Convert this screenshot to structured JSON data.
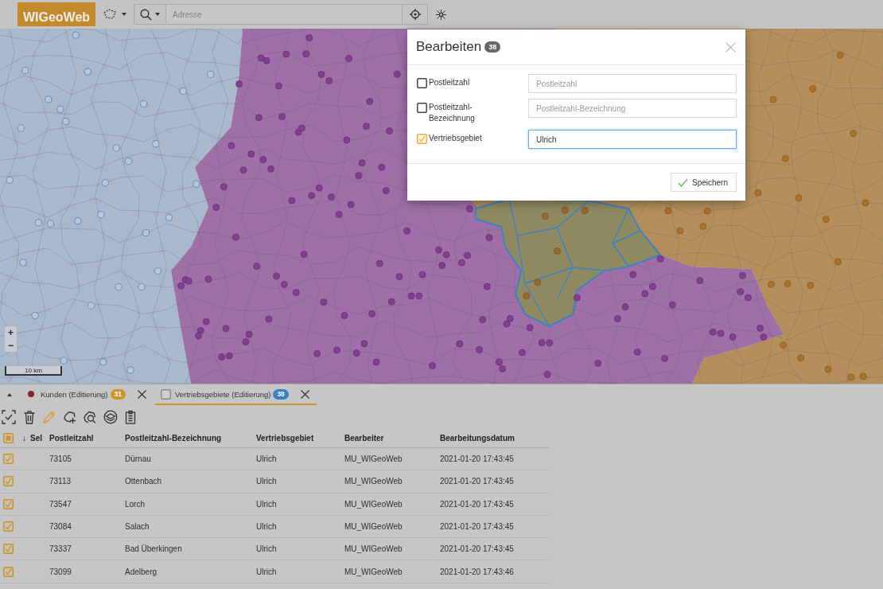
{
  "toolbar": {
    "logo": "WIGeoWeb",
    "address_field": {
      "placeholder": "Adresse"
    }
  },
  "map": {
    "zoom_in": "+",
    "zoom_out": "−",
    "scale_label": "10 km"
  },
  "dialog": {
    "title": "Bearbeiten",
    "count": "38",
    "fields": [
      {
        "label": "Postleitzahl",
        "checked": false,
        "placeholder": "Postleitzahl",
        "focused": false
      },
      {
        "label": "Postleitzahl-Bezeichnung",
        "checked": false,
        "placeholder": "Postleitzahl-Bezeichnung",
        "focused": false
      },
      {
        "label": "Vertriebsgebiet",
        "checked": true,
        "value": "Ulrich",
        "focused": true
      }
    ],
    "save_button": "Speichern"
  },
  "panel": {
    "tabs": [
      {
        "kind": "dot",
        "label": "Kunden (Editierung)",
        "count": "31",
        "color": "#c8962a",
        "marker": {
          "color": "#8b2232"
        },
        "selected": false
      },
      {
        "kind": "checkbox",
        "label": "Vertriebsgebiete (Editierung)",
        "count": "38",
        "color": "#3b7fc4",
        "checked": false,
        "selected": true
      }
    ],
    "tools": [
      {
        "kind": "select",
        "active": false
      },
      {
        "kind": "delete",
        "active": false
      },
      {
        "kind": "edit",
        "active": true
      },
      {
        "kind": "add-area",
        "active": false
      },
      {
        "kind": "search-area",
        "active": false
      },
      {
        "kind": "layers",
        "active": false
      },
      {
        "kind": "report",
        "active": false
      }
    ],
    "table": {
      "select_all": {
        "checked": true
      },
      "columns": [
        {
          "label": "Sel",
          "sort_indicator": "↓"
        },
        {
          "label": "Postleitzahl"
        },
        {
          "label": "Postleitzahl-Bezeichnung"
        },
        {
          "label": "Vertriebsgebiet"
        },
        {
          "label": "Bearbeiter"
        },
        {
          "label": "Bearbeitungsdatum"
        }
      ],
      "rows": [
        {
          "checked": true,
          "cells": [
            "",
            "73105",
            "Dürnau",
            "Ulrich",
            "MU_WIGeoWeb",
            "2021-01-20 17:43:45"
          ]
        },
        {
          "checked": true,
          "cells": [
            "",
            "73113",
            "Ottenbach",
            "Ulrich",
            "MU_WIGeoWeb",
            "2021-01-20 17:43:45"
          ]
        },
        {
          "checked": true,
          "cells": [
            "",
            "73547",
            "Lorch",
            "Ulrich",
            "MU_WIGeoWeb",
            "2021-01-20 17:43:45"
          ]
        },
        {
          "checked": true,
          "cells": [
            "",
            "73084",
            "Salach",
            "Ulrich",
            "MU_WIGeoWeb",
            "2021-01-20 17:43:45"
          ]
        },
        {
          "checked": true,
          "cells": [
            "",
            "73337",
            "Bad Überkingen",
            "Ulrich",
            "MU_WIGeoWeb",
            "2021-01-20 17:43:45"
          ]
        },
        {
          "checked": true,
          "cells": [
            "",
            "73099",
            "Adelberg",
            "Ulrich",
            "MU_WIGeoWeb",
            "2021-01-20 17:43:46"
          ]
        }
      ]
    }
  }
}
